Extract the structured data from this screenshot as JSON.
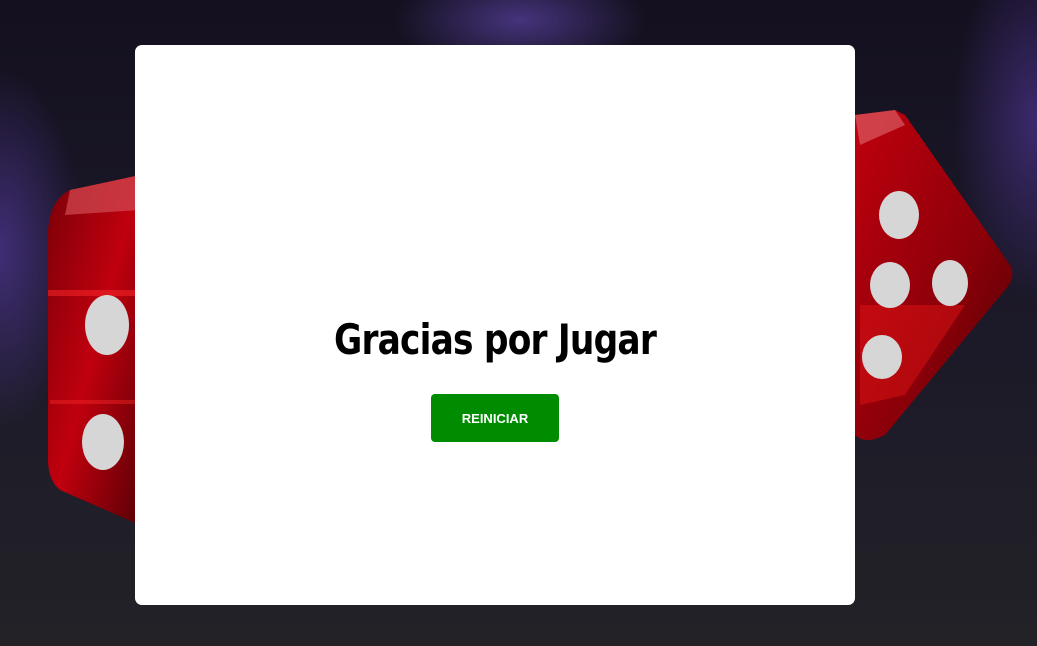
{
  "modal": {
    "title": "Gracias por Jugar",
    "restart_label": "REINICIAR"
  },
  "colors": {
    "button_bg": "#008c00",
    "button_text": "#ffffff",
    "modal_bg": "#ffffff",
    "die_red": "#b3000b",
    "pip": "#d9d9d9"
  }
}
